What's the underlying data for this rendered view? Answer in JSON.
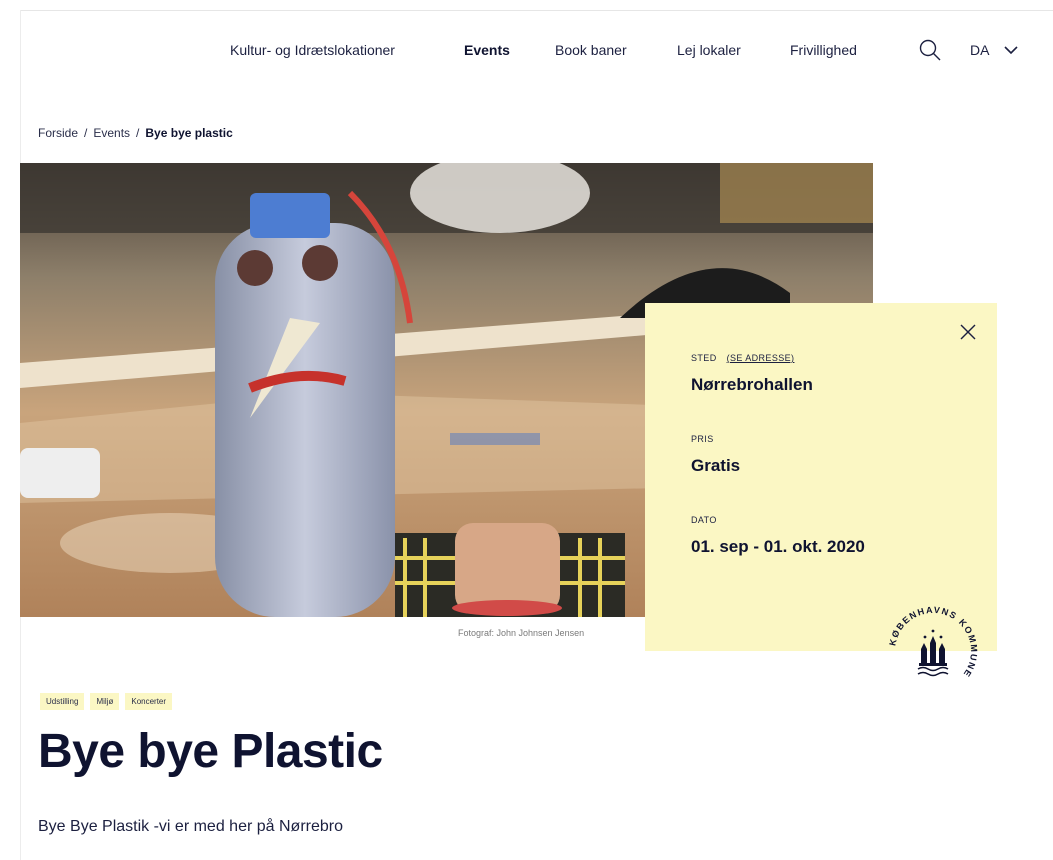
{
  "nav": {
    "items": [
      {
        "label": "Kultur- og Idrætslokationer"
      },
      {
        "label": "Events"
      },
      {
        "label": "Book baner"
      },
      {
        "label": "Lej lokaler"
      },
      {
        "label": "Frivillighed"
      }
    ],
    "active": "Events",
    "language": "DA",
    "search_icon": "search-icon",
    "lang_icon": "chevron-down-icon"
  },
  "breadcrumb": {
    "items": [
      "Forside",
      "Events",
      "Bye bye plastic"
    ],
    "separator": "/"
  },
  "hero": {
    "photo_credit": "Fotograf: John Johnsen Jensen"
  },
  "info_card": {
    "close_icon": "close-icon",
    "sted_label": "STED",
    "address_link": "(SE ADRESSE)",
    "sted_value": "Nørrebrohallen",
    "pris_label": "PRIS",
    "pris_value": "Gratis",
    "dato_label": "DATO",
    "dato_value": "01. sep - 01. okt. 2020",
    "background": "#fbf7c4"
  },
  "logo": {
    "name": "københavns-kommune-seal",
    "text": "KØBENHAVNS KOMMUNE"
  },
  "tags": [
    "Udstilling",
    "Miljø",
    "Koncerter"
  ],
  "event": {
    "title": "Bye bye Plastic",
    "description": "Bye Bye Plastik -vi er med her på Nørrebro"
  },
  "colors": {
    "text": "#0f1330",
    "accent_yellow": "#fbf7c4"
  }
}
